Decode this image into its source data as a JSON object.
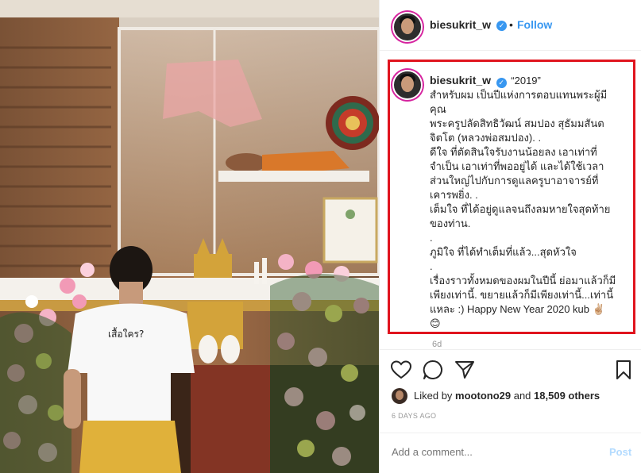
{
  "post": {
    "username": "biesukrit_w",
    "follow_label": "Follow",
    "dot": "•",
    "caption_quote": "“2019”",
    "caption_lines": [
      "สำหรับผม เป็นปีแห่งการตอบแทนพระผู้มี",
      "คุณ",
      "พระครูปลัดสิทธิวัฒน์ สมปอง สุธัมมสันต",
      "จิตโต (หลวงพ่อสมปอง). .",
      "ดีใจ ที่ตัดสินใจรับงานน้อยลง เอาเท่าที่",
      "จำเป็น เอาเท่าที่พออยู่ได้ และได้ใช้เวลา",
      "ส่วนใหญ่ไปกับการดูแลครูบาอาจารย์ที่",
      "เคารพยิ่ง. .",
      "เต็มใจ ที่ได้อยู่ดูแลจนถึงลมหายใจสุดท้าย",
      "ของท่าน.",
      ".",
      "ภูมิใจ ที่ได้ทำเต็มที่แล้ว...สุดหัวใจ",
      ".",
      "เรื่องราวทั้งหมดของผมในปีนี้ ย่อมาแล้วก็มี",
      "เพียงเท่านี้. ขยายแล้วก็มีเพียงเท่านี้...เท่านี้",
      "แหละ :) Happy New Year 2020 kub ✌🏼",
      "😊"
    ],
    "caption_age": "6d",
    "liked_by_prefix": "Liked by ",
    "liked_by_user": "mootono29",
    "liked_by_and": " and ",
    "liked_by_count": "18,509 others",
    "date": "6 DAYS AGO",
    "comment_placeholder": "Add a comment...",
    "post_label": "Post"
  },
  "photo": {
    "shirt_text": "เสื้อใคร?"
  },
  "icons": {
    "like": "heart-icon",
    "comment": "comment-icon",
    "share": "share-icon",
    "save": "bookmark-icon"
  },
  "colors": {
    "accent": "#3897f0",
    "highlight_box": "#e0141e",
    "verified": "#3897f0",
    "muted": "#999999"
  }
}
